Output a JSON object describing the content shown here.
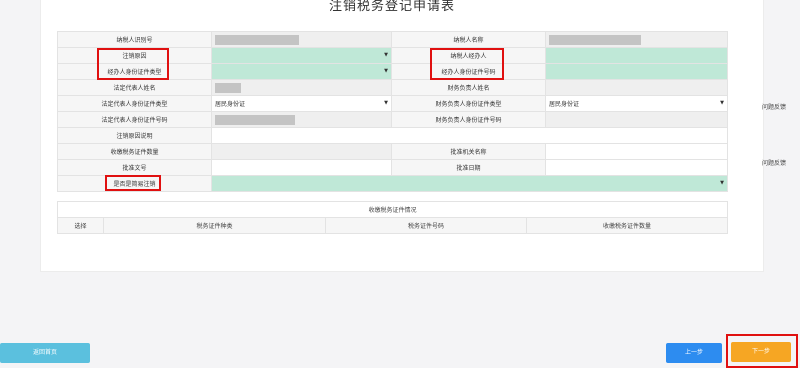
{
  "title": "注销税务登记申请表",
  "rows": [
    {
      "l1": "纳税人识别号",
      "v1": "",
      "l2": "纳税人名称",
      "v2": ""
    },
    {
      "l1": "注销原因",
      "v1": "",
      "l2": "纳税人经办人",
      "v2": ""
    },
    {
      "l1": "经办人身份证件类型",
      "v1": "",
      "l2": "经办人身份证件号码",
      "v2": ""
    },
    {
      "l1": "法定代表人姓名",
      "v1": "",
      "l2": "财务负责人姓名",
      "v2": ""
    },
    {
      "l1": "法定代表人身份证件类型",
      "v1": "居民身份证",
      "l2": "财务负责人身份证件类型",
      "v2": "居民身份证"
    },
    {
      "l1": "法定代表人身份证件号码",
      "v1": "",
      "l2": "财务负责人身份证件号码",
      "v2": ""
    },
    {
      "l1": "注销原因说明",
      "v1": ""
    },
    {
      "l1": "收缴税务证件数量",
      "v1": "",
      "l2": "批准机关名称",
      "v2": ""
    },
    {
      "l1": "批准文号",
      "v1": "",
      "l2": "批准日期",
      "v2": ""
    },
    {
      "l1": "是否是简易注销",
      "v1": ""
    }
  ],
  "cert": {
    "heading": "收缴税务证件情况",
    "columns": [
      "选择",
      "税务证件种类",
      "税务证件号码",
      "收缴税务证件数量"
    ]
  },
  "side": {
    "feedback1": "问题反馈",
    "feedback2": "问题反馈"
  },
  "buttons": {
    "home": "返回首页",
    "prev": "上一步",
    "next": "下一步"
  },
  "colors": {
    "required_fill": "#bfe8d7",
    "home_btn": "#5bc0de",
    "prev_btn": "#2d8cf0",
    "next_btn": "#f6a623",
    "highlight": "#e01010"
  }
}
